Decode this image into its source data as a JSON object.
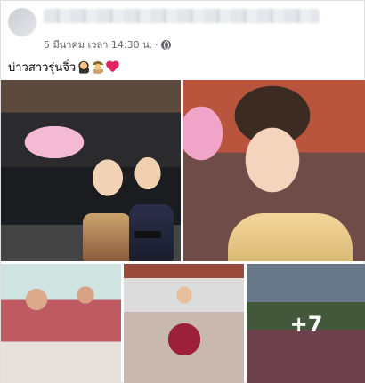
{
  "post": {
    "timestamp": "5 มีนาคม เวลา 14:30 น.",
    "separator": "·",
    "caption_text": "บ่าวสาวรุ่นจิ๋ว",
    "caption_emojis": [
      "person-bowing-emoji",
      "person-hat-emoji",
      "red-heart-emoji"
    ]
  },
  "gallery": {
    "photo_count": 5,
    "more_count_label": "+7"
  },
  "colors": {
    "meta_text": "#65676b",
    "heart": "#e0245e",
    "card_border": "#dddfe2"
  }
}
